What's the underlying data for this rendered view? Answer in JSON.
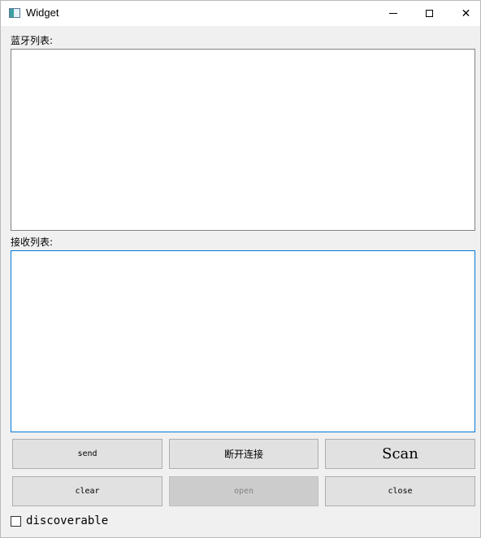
{
  "window": {
    "title": "Widget",
    "icon": "app-window-icon",
    "controls": {
      "minimize": "minimize-icon",
      "maximize": "maximize-icon",
      "close": "close-icon",
      "close_glyph": "✕"
    }
  },
  "bluetooth_list": {
    "label": "蓝牙列表:",
    "items": []
  },
  "receive_list": {
    "label": "接收列表:",
    "items": []
  },
  "buttons": {
    "send": "send",
    "disconnect": "断开连接",
    "scan": "Scan",
    "clear": "clear",
    "open": "open",
    "close": "close"
  },
  "discoverable": {
    "label": "discoverable",
    "checked": false
  }
}
